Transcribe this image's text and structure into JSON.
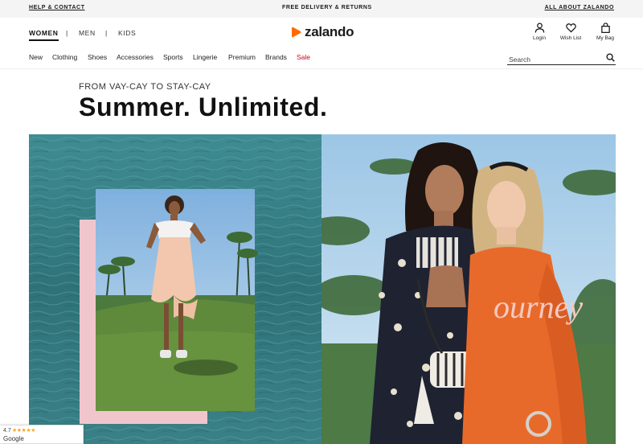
{
  "topbar": {
    "help": "HELP & CONTACT",
    "delivery": "FREE DELIVERY & RETURNS",
    "about": "ALL ABOUT ZALANDO"
  },
  "header": {
    "genders": [
      "WOMEN",
      "MEN",
      "KIDS"
    ],
    "separator": "|",
    "active_gender": "WOMEN",
    "brand": "zalando",
    "brand_color": "#ff6900",
    "utility": {
      "login": "Login",
      "wishlist": "Wish List",
      "bag": "My Bag"
    }
  },
  "categories": [
    "New",
    "Clothing",
    "Shoes",
    "Accessories",
    "Sports",
    "Lingerie",
    "Premium",
    "Brands",
    "Sale"
  ],
  "sale_color": "#d0021b",
  "search": {
    "placeholder": "Search"
  },
  "hero": {
    "eyebrow": "FROM VAY-CAY TO STAY-CAY",
    "headline": "Summer. Unlimited.",
    "printed_word": "ourney"
  },
  "rating_badge": {
    "score": "4.7",
    "stars": "★★★★★",
    "provider": "Google"
  }
}
